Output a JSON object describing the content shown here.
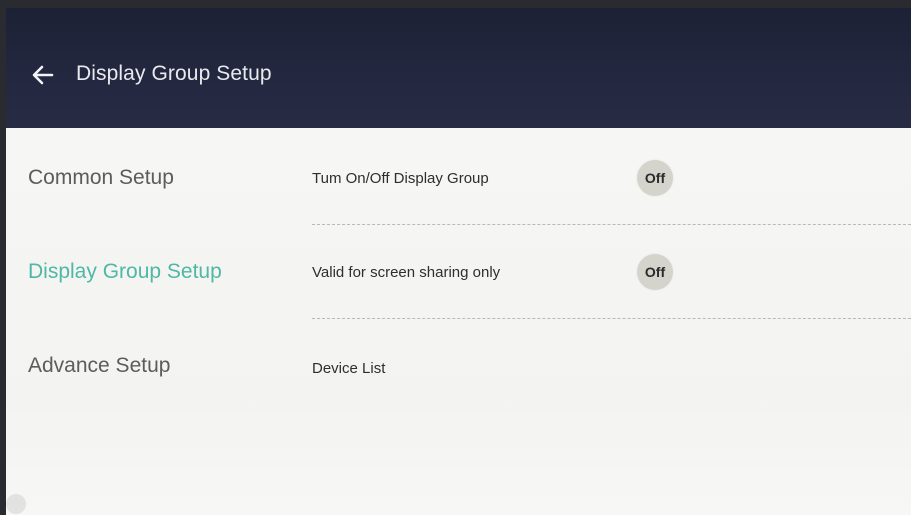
{
  "header": {
    "back_icon": "arrow-left-icon",
    "title": "Display Group Setup"
  },
  "sidebar": {
    "items": [
      {
        "label": "Common Setup",
        "active": false
      },
      {
        "label": "Display Group Setup",
        "active": true
      },
      {
        "label": "Advance Setup",
        "active": false
      }
    ]
  },
  "settings": {
    "rows": [
      {
        "label": "Tum On/Off Display Group",
        "toggle": "Off"
      },
      {
        "label": "Valid for screen sharing only",
        "toggle": "Off"
      },
      {
        "label": "Device List"
      }
    ]
  },
  "colors": {
    "header_bg": "#1d2135",
    "active_accent": "#4fb8a4",
    "toggle_bg": "#d4d3cc"
  }
}
